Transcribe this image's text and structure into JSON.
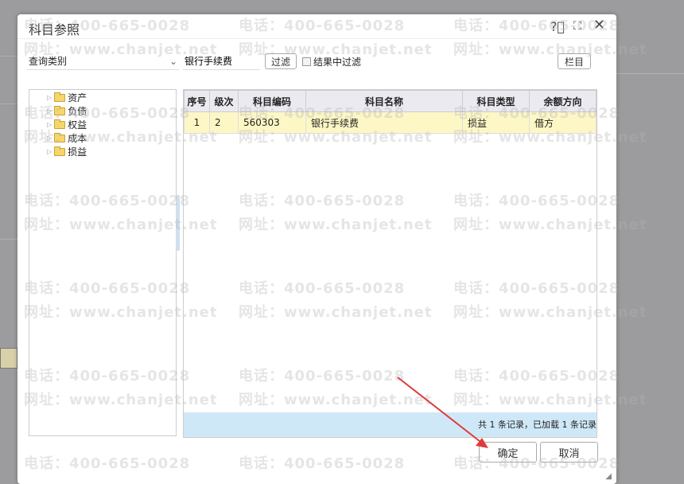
{
  "dialog": {
    "title": "科目参照",
    "icons": [
      "help-icon",
      "maximize-icon",
      "close-icon"
    ]
  },
  "toolbar": {
    "category_select": "查询类别",
    "search_value": "银行手续费",
    "filter_button": "过滤",
    "filter_in_results_label": "结果中过滤",
    "columns_button": "栏目"
  },
  "tree": {
    "items": [
      {
        "label": "资产"
      },
      {
        "label": "负债"
      },
      {
        "label": "权益"
      },
      {
        "label": "成本"
      },
      {
        "label": "损益"
      }
    ]
  },
  "grid": {
    "headers": [
      "序号",
      "级次",
      "科目编码",
      "科目名称",
      "科目类型",
      "余额方向"
    ],
    "rows": [
      [
        "1",
        "2",
        "560303",
        "银行手续费",
        "损益",
        "借方"
      ]
    ],
    "footer": "共 1 条记录，已加载 1 条记录"
  },
  "buttons": {
    "ok": "确定",
    "cancel": "取消"
  },
  "watermark": {
    "phone": "电话：400-665-0028",
    "site": "网址：www.chanjet.net"
  },
  "colors": {
    "row_highlight": "#fdf7c6",
    "footer_bg": "#cfe8f8",
    "annotation_arrow": "#e03b3b"
  }
}
